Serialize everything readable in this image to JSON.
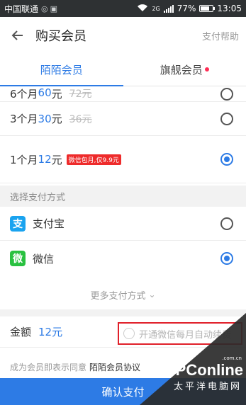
{
  "status_bar": {
    "carrier": "中国联通",
    "network": "2G",
    "battery": "77%",
    "battery_level": 0.77,
    "time": "13:05"
  },
  "header": {
    "back_icon": "arrow-left-icon",
    "title": "购买会员",
    "help_label": "支付帮助"
  },
  "tabs": [
    {
      "label": "陌陌会员",
      "active": true
    },
    {
      "label": "旗舰会员",
      "active": false,
      "badge_dot": true
    }
  ],
  "plans": [
    {
      "duration": "6个月",
      "price": "60",
      "unit": "元",
      "original": "72元",
      "selected": false
    },
    {
      "duration": "3个月",
      "price": "30",
      "unit": "元",
      "original": "36元",
      "selected": false
    },
    {
      "duration": "1个月",
      "price": "12",
      "unit": "元",
      "promo": "微信包月,仅9.9元",
      "selected": true
    }
  ],
  "payment": {
    "section_label": "选择支付方式",
    "methods": [
      {
        "name": "支付宝",
        "icon": "alipay-icon",
        "icon_glyph": "支",
        "selected": false
      },
      {
        "name": "微信",
        "icon": "wechat-icon",
        "icon_glyph": "微",
        "selected": true
      }
    ],
    "more_label": "更多支付方式"
  },
  "amount": {
    "label": "金额",
    "value": "12元"
  },
  "auto_renew": {
    "label": "开通微信每月自动续费"
  },
  "agreement": {
    "prefix": "成为会员即表示同意",
    "link": "陌陌会员协议"
  },
  "confirm_label": "确认支付",
  "watermark": {
    "brand": "PConline",
    "domain": ".com.cn",
    "sub": "太平洋电脑网"
  },
  "colors": {
    "accent": "#2d7be5",
    "promo": "#ee2b2b",
    "highlight_box": "#e0202a",
    "status_bar": "#2e3133"
  }
}
